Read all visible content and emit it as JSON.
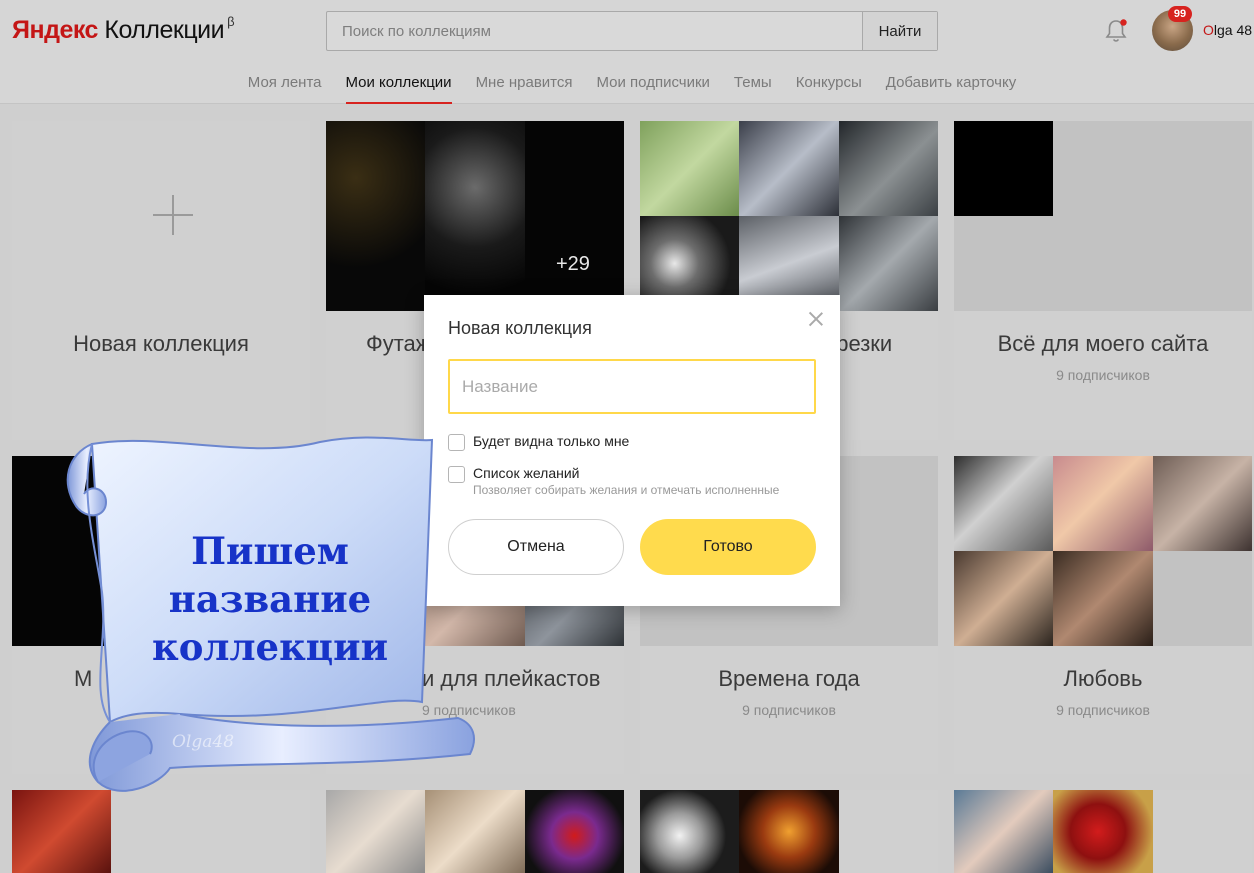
{
  "header": {
    "logo_brand": "Яндекс",
    "logo_product": "Коллекции",
    "logo_beta": "β",
    "search_placeholder": "Поиск по коллекциям",
    "search_button": "Найти",
    "notifications_badge": "99",
    "user_initial": "O",
    "user_rest": "lga 48"
  },
  "nav": {
    "items": [
      "Моя лента",
      "Мои коллекции",
      "Мне нравится",
      "Мои подписчики",
      "Темы",
      "Конкурсы",
      "Добавить карточку"
    ],
    "active": "Мои коллекции"
  },
  "cards": {
    "new": {
      "title": "Новая коллекция"
    },
    "futazhi": {
      "title": "Футаж",
      "more": "+29"
    },
    "narezki": {
      "title": "арезки"
    },
    "site": {
      "title": "Всё для моего сайта",
      "subs": "9 подписчиков"
    },
    "m": {
      "title": "М"
    },
    "playcasts": {
      "title": "и для плейкастов",
      "subs": "9 подписчиков"
    },
    "seasons": {
      "title": "Времена года",
      "subs": "9 подписчиков"
    },
    "love": {
      "title": "Любовь",
      "subs": "9 подписчиков"
    }
  },
  "dialog": {
    "title": "Новая коллекция",
    "name_placeholder": "Название",
    "private_label": "Будет видна только мне",
    "wishlist_label": "Список желаний",
    "wishlist_hint": "Позволяет собирать желания и отмечать исполненные",
    "cancel": "Отмена",
    "done": "Готово"
  },
  "overlay": {
    "line1": "Пишем",
    "line2": "название",
    "line3": "коллекции",
    "watermark": "Olga48"
  }
}
